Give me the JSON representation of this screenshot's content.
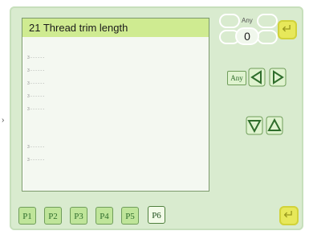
{
  "param_list": {
    "title": "21 Thread trim length",
    "rows": [
      "3 - - - - - -",
      "3 - - - - - -",
      "3 - - - - - -",
      "3 - - - - - -",
      "3 - - - - - -",
      "3 - - - - - -",
      "3 - - - - - -"
    ]
  },
  "pages": {
    "labels": [
      "P1",
      "P2",
      "P3",
      "P4",
      "P5",
      "P6"
    ],
    "active": "P6"
  },
  "value_input": {
    "any_label": "Any",
    "value": "0"
  },
  "controls": {
    "any_button_label": "Any",
    "prev_symbol": "◁",
    "next_symbol": "▷",
    "down_symbol": "▽",
    "up_symbol": "△",
    "enter_symbol": "↵"
  },
  "pointer_symbol": "›",
  "colors": {
    "accent_title": "#cfeb91",
    "panel_bg": "#f4f8f1",
    "screen_bg": "#d9ebcf",
    "button_green": "#bfe59a",
    "gold": "#e7e85a"
  }
}
